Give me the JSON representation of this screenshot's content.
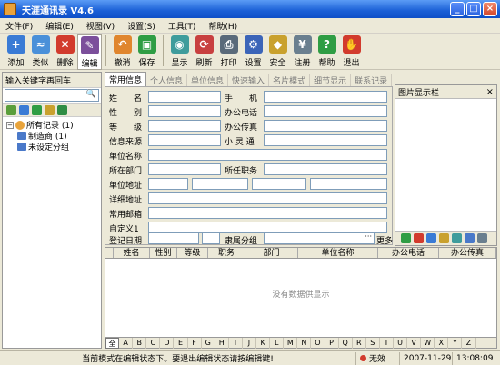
{
  "window": {
    "title": "天涯通讯录 V4.6"
  },
  "menu": [
    "文件(F)",
    "编辑(E)",
    "视图(V)",
    "设置(S)",
    "工具(T)",
    "帮助(H)"
  ],
  "toolbar": [
    {
      "label": "添加",
      "icon": "add-contact-icon",
      "color": "#3a7bd5",
      "glyph": "+"
    },
    {
      "label": "类似",
      "icon": "similar-contact-icon",
      "color": "#4a90d9",
      "glyph": "≈"
    },
    {
      "label": "删除",
      "icon": "delete-icon",
      "color": "#d23b2d",
      "glyph": "✕"
    },
    {
      "label": "编辑",
      "icon": "edit-icon",
      "color": "#7c4f9b",
      "glyph": "✎"
    },
    {
      "label": "撤消",
      "icon": "undo-icon",
      "color": "#e0862e",
      "glyph": "↶"
    },
    {
      "label": "保存",
      "icon": "save-icon",
      "color": "#2f9d44",
      "glyph": "▣"
    },
    {
      "label": "显示",
      "icon": "show-icon",
      "color": "#3f9c9c",
      "glyph": "◉"
    },
    {
      "label": "刷新",
      "icon": "refresh-icon",
      "color": "#c84040",
      "glyph": "⟳"
    },
    {
      "label": "打印",
      "icon": "print-icon",
      "color": "#5a6a7a",
      "glyph": "⎙"
    },
    {
      "label": "设置",
      "icon": "settings-icon",
      "color": "#3b64b8",
      "glyph": "⚙"
    },
    {
      "label": "安全",
      "icon": "security-icon",
      "color": "#c9a12e",
      "glyph": "◆"
    },
    {
      "label": "注册",
      "icon": "register-icon",
      "color": "#6a7f8f",
      "glyph": "¥"
    },
    {
      "label": "帮助",
      "icon": "help-icon",
      "color": "#2f9d44",
      "glyph": "?"
    },
    {
      "label": "退出",
      "icon": "exit-icon",
      "color": "#d23b2d",
      "glyph": "✋"
    }
  ],
  "left_panel": {
    "header": "输入关键字再回车",
    "tree": [
      {
        "label": "所有记录 (1)",
        "level": 0,
        "icon": "all-records-icon"
      },
      {
        "label": "制造商 (1)",
        "level": 1,
        "icon": "group-icon"
      },
      {
        "label": "未设定分组",
        "level": 1,
        "icon": "group-icon"
      }
    ]
  },
  "tabs": [
    "常用信息",
    "个人信息",
    "单位信息",
    "快速输入",
    "名片模式",
    "细节显示",
    "联系记录"
  ],
  "form": {
    "name": "姓　　名",
    "mobile": "手　　机",
    "gender": "性　　别",
    "office_phone": "办公电话",
    "level": "等　　级",
    "office_fax": "办公传真",
    "info_source": "信息来源",
    "xlt": "小 灵 通",
    "company": "单位名称",
    "department": "所在部门",
    "position": "所任职务",
    "address": "单位地址",
    "detail_address": "详细地址",
    "email": "常用邮箱",
    "custom1": "自定义1",
    "reg_date": "登记日期",
    "group": "隶属分组",
    "more": "更多"
  },
  "picture_panel": {
    "title": "图片显示栏"
  },
  "grid": {
    "columns": [
      "姓名",
      "性别",
      "等级",
      "职务",
      "部门",
      "单位名称",
      "办公电话",
      "办公传真"
    ],
    "empty_text": "没有数据供显示",
    "alphabet": [
      "全",
      "A",
      "B",
      "C",
      "D",
      "E",
      "F",
      "G",
      "H",
      "I",
      "J",
      "K",
      "L",
      "M",
      "N",
      "O",
      "P",
      "Q",
      "R",
      "S",
      "T",
      "U",
      "V",
      "W",
      "X",
      "Y",
      "Z"
    ]
  },
  "status": {
    "message": "当前模式在编辑状态下。要退出编辑状态请按编辑键!",
    "state": "无效",
    "date": "2007-11-29",
    "time": "13:08:09"
  }
}
